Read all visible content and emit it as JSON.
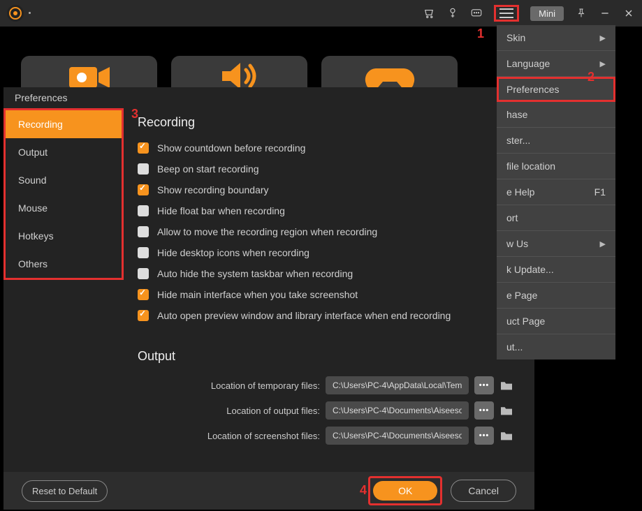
{
  "titlebar": {
    "mini": "Mini"
  },
  "annotations": {
    "n1": "1",
    "n2": "2",
    "n3": "3",
    "n4": "4"
  },
  "menu": {
    "skin": "Skin",
    "language": "Language",
    "preferences": "Preferences",
    "hase": "hase",
    "ster": "ster...",
    "file_location": "file location",
    "help": "e Help",
    "help_key": "F1",
    "ort": "ort",
    "w_us": "w Us",
    "k_update": "k Update...",
    "e_page": "e Page",
    "uct_page": "uct Page",
    "ut": "ut..."
  },
  "modal": {
    "title": "Preferences",
    "sidebar": {
      "recording": "Recording",
      "output": "Output",
      "sound": "Sound",
      "mouse": "Mouse",
      "hotkeys": "Hotkeys",
      "others": "Others"
    },
    "recording": {
      "heading": "Recording",
      "show_countdown": "Show countdown before recording",
      "beep": "Beep on start recording",
      "show_boundary": "Show recording boundary",
      "hide_float": "Hide float bar when recording",
      "allow_move": "Allow to move the recording region when recording",
      "hide_desktop": "Hide desktop icons when recording",
      "auto_hide_taskbar": "Auto hide the system taskbar when recording",
      "hide_main": "Hide main interface when you take screenshot",
      "auto_preview": "Auto open preview window and library interface when end recording"
    },
    "output": {
      "heading": "Output",
      "temp_label": "Location of temporary files:",
      "temp_value": "C:\\Users\\PC-4\\AppData\\Local\\Tem",
      "out_label": "Location of output files:",
      "out_value": "C:\\Users\\PC-4\\Documents\\Aiseeso",
      "shot_label": "Location of screenshot files:",
      "shot_value": "C:\\Users\\PC-4\\Documents\\Aiseeso"
    },
    "footer": {
      "reset": "Reset to Default",
      "ok": "OK",
      "cancel": "Cancel"
    }
  }
}
